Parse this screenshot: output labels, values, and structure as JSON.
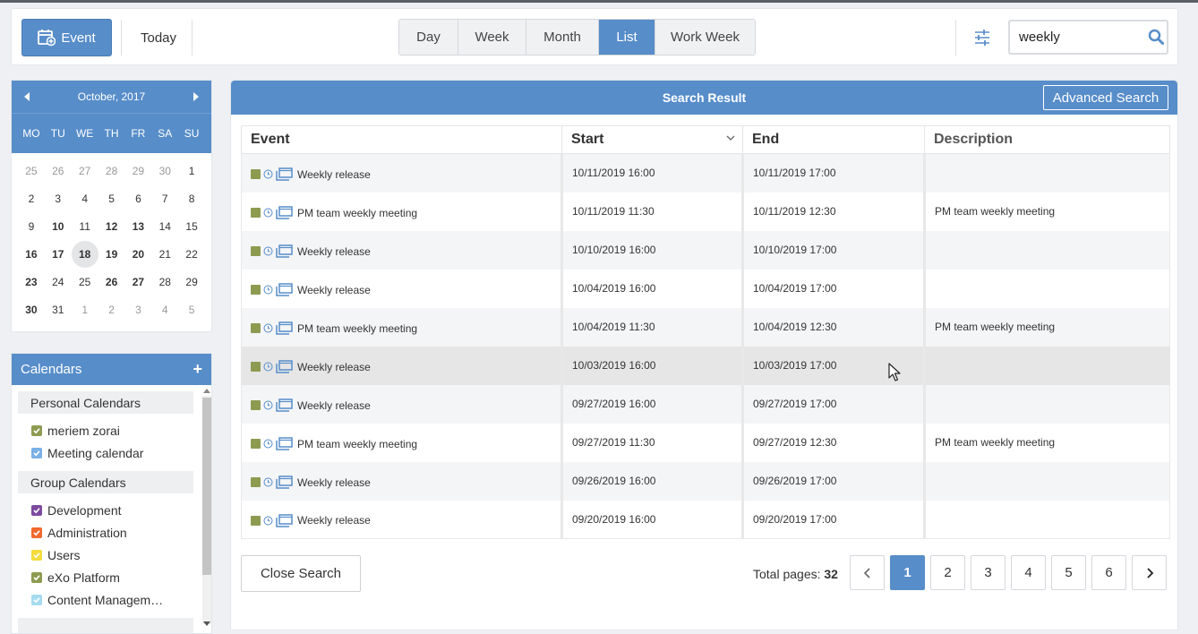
{
  "toolbar": {
    "event_label": "Event",
    "today_label": "Today",
    "views": [
      "Day",
      "Week",
      "Month",
      "List",
      "Work Week"
    ],
    "active_view": "List",
    "search_value": "weekly"
  },
  "minical": {
    "month_label": "October, 2017",
    "weekdays": [
      "MO",
      "TU",
      "WE",
      "TH",
      "FR",
      "SA",
      "SU"
    ],
    "weeks": [
      [
        {
          "d": "25",
          "m": 1
        },
        {
          "d": "26",
          "m": 1
        },
        {
          "d": "27",
          "m": 1
        },
        {
          "d": "28",
          "m": 1
        },
        {
          "d": "29",
          "m": 1
        },
        {
          "d": "30",
          "m": 1
        },
        {
          "d": "1"
        }
      ],
      [
        {
          "d": "2"
        },
        {
          "d": "3"
        },
        {
          "d": "4"
        },
        {
          "d": "5"
        },
        {
          "d": "6"
        },
        {
          "d": "7"
        },
        {
          "d": "8"
        }
      ],
      [
        {
          "d": "9"
        },
        {
          "d": "10",
          "b": 1
        },
        {
          "d": "11"
        },
        {
          "d": "12",
          "b": 1
        },
        {
          "d": "13",
          "b": 1
        },
        {
          "d": "14"
        },
        {
          "d": "15"
        }
      ],
      [
        {
          "d": "16",
          "b": 1
        },
        {
          "d": "17",
          "b": 1
        },
        {
          "d": "18",
          "t": 1
        },
        {
          "d": "19",
          "b": 1
        },
        {
          "d": "20",
          "b": 1
        },
        {
          "d": "21"
        },
        {
          "d": "22"
        }
      ],
      [
        {
          "d": "23",
          "b": 1
        },
        {
          "d": "24"
        },
        {
          "d": "25"
        },
        {
          "d": "26",
          "b": 1
        },
        {
          "d": "27",
          "b": 1
        },
        {
          "d": "28"
        },
        {
          "d": "29"
        }
      ],
      [
        {
          "d": "30",
          "b": 1
        },
        {
          "d": "31"
        },
        {
          "d": "1",
          "m": 1
        },
        {
          "d": "2",
          "m": 1
        },
        {
          "d": "3",
          "m": 1
        },
        {
          "d": "4",
          "m": 1
        },
        {
          "d": "5",
          "m": 1
        }
      ]
    ]
  },
  "calendars": {
    "title": "Calendars",
    "personal_title": "Personal Calendars",
    "personal": [
      {
        "name": "meriem zorai",
        "color": "#8d9b51"
      },
      {
        "name": "Meeting calendar",
        "color": "#7ab0e6"
      }
    ],
    "group_title": "Group Calendars",
    "group": [
      {
        "name": "Development",
        "color": "#7d4aa0"
      },
      {
        "name": "Administration",
        "color": "#f06a2f"
      },
      {
        "name": "Users",
        "color": "#f4dc3c"
      },
      {
        "name": "eXo Platform",
        "color": "#8d9b51"
      },
      {
        "name": "Content Managem…",
        "color": "#a6dcf0"
      }
    ]
  },
  "results": {
    "title": "Search Result",
    "advanced_label": "Advanced Search",
    "columns": [
      "Event",
      "Start",
      "End",
      "Description"
    ],
    "rows": [
      {
        "event": "Weekly release",
        "start": "10/11/2019 16:00",
        "end": "10/11/2019 17:00",
        "description": ""
      },
      {
        "event": "PM team weekly meeting",
        "start": "10/11/2019 11:30",
        "end": "10/11/2019 12:30",
        "description": "PM team weekly meeting"
      },
      {
        "event": "Weekly release",
        "start": "10/10/2019 16:00",
        "end": "10/10/2019 17:00",
        "description": ""
      },
      {
        "event": "Weekly release",
        "start": "10/04/2019 16:00",
        "end": "10/04/2019 17:00",
        "description": ""
      },
      {
        "event": "PM team weekly meeting",
        "start": "10/04/2019 11:30",
        "end": "10/04/2019 12:30",
        "description": "PM team weekly meeting"
      },
      {
        "event": "Weekly release",
        "start": "10/03/2019 16:00",
        "end": "10/03/2019 17:00",
        "description": ""
      },
      {
        "event": "Weekly release",
        "start": "09/27/2019 16:00",
        "end": "09/27/2019 17:00",
        "description": ""
      },
      {
        "event": "PM team weekly meeting",
        "start": "09/27/2019 11:30",
        "end": "09/27/2019 12:30",
        "description": "PM team weekly meeting"
      },
      {
        "event": "Weekly release",
        "start": "09/26/2019 16:00",
        "end": "09/26/2019 17:00",
        "description": ""
      },
      {
        "event": "Weekly release",
        "start": "09/20/2019 16:00",
        "end": "09/20/2019 17:00",
        "description": ""
      }
    ],
    "close_label": "Close Search",
    "total_label": "Total pages:",
    "total_pages": "32",
    "pages": [
      "1",
      "2",
      "3",
      "4",
      "5",
      "6"
    ],
    "current_page": "1"
  },
  "colors": {
    "accent": "#578dc9",
    "event_square": "#8d9b51"
  }
}
